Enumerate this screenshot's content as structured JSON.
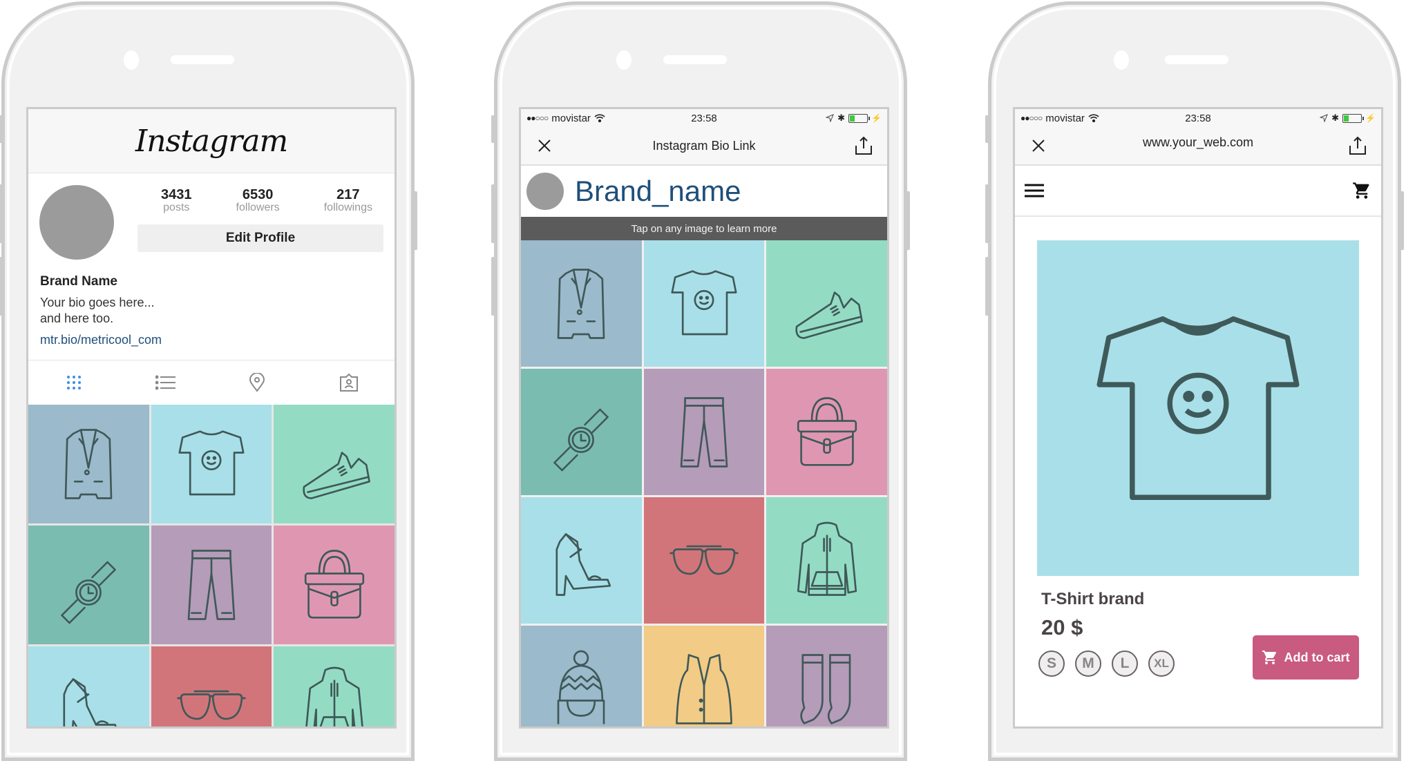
{
  "colors": {
    "tile_blue_gray": "#9bbacb",
    "tile_light_blue": "#a9dfe8",
    "tile_mint": "#93dcc3",
    "tile_teal": "#7bbcb0",
    "tile_mauve": "#b59cb9",
    "tile_pink": "#df97b1",
    "tile_red": "#d2757a",
    "tile_yellow": "#f2cb86",
    "link": "#1f4f7a",
    "accent_tab": "#3d8fe0",
    "add_to_cart": "#c95a80"
  },
  "phone1": {
    "app_logo": "Instagram",
    "stats": [
      {
        "value": "3431",
        "label": "posts"
      },
      {
        "value": "6530",
        "label": "followers"
      },
      {
        "value": "217",
        "label": "followings"
      }
    ],
    "edit_profile_label": "Edit Profile",
    "brand_name": "Brand Name",
    "bio": "Your bio goes here...\nand here too.",
    "link": "mtr.bio/metricool_com",
    "tabs": [
      "grid-icon",
      "list-icon",
      "location-pin-icon",
      "tagged-user-icon"
    ],
    "grid": [
      {
        "item": "blazer",
        "color": "#9bbacb"
      },
      {
        "item": "t-shirt",
        "color": "#a9dfe8"
      },
      {
        "item": "sneaker",
        "color": "#93dcc3"
      },
      {
        "item": "watch",
        "color": "#7bbcb0"
      },
      {
        "item": "pants",
        "color": "#b59cb9"
      },
      {
        "item": "handbag",
        "color": "#df97b1"
      },
      {
        "item": "heel-sandal",
        "color": "#a9dfe8"
      },
      {
        "item": "sunglasses",
        "color": "#d2757a"
      },
      {
        "item": "hoodie",
        "color": "#93dcc3"
      }
    ]
  },
  "phone2": {
    "status": {
      "carrier": "movistar",
      "signal": "●●○○○",
      "time": "23:58"
    },
    "nav_title": "Instagram Bio Link",
    "brand_name": "Brand_name",
    "tap_hint": "Tap on any image to learn more",
    "grid": [
      {
        "item": "blazer",
        "color": "#9bbacb"
      },
      {
        "item": "t-shirt",
        "color": "#a9dfe8"
      },
      {
        "item": "sneaker",
        "color": "#93dcc3"
      },
      {
        "item": "watch",
        "color": "#7bbcb0"
      },
      {
        "item": "pants",
        "color": "#b59cb9"
      },
      {
        "item": "handbag",
        "color": "#df97b1"
      },
      {
        "item": "heel-sandal",
        "color": "#a9dfe8"
      },
      {
        "item": "sunglasses",
        "color": "#d2757a"
      },
      {
        "item": "hoodie",
        "color": "#93dcc3"
      },
      {
        "item": "beanie",
        "color": "#9bbacb"
      },
      {
        "item": "vest",
        "color": "#f2cb86"
      },
      {
        "item": "socks",
        "color": "#b59cb9"
      }
    ]
  },
  "phone3": {
    "status": {
      "carrier": "movistar",
      "signal": "●●○○○",
      "time": "23:58"
    },
    "nav_title": "www.your_web.com",
    "product_name": "T-Shirt brand",
    "price": "20 $",
    "sizes": [
      "S",
      "M",
      "L",
      "XL"
    ],
    "add_to_cart_label": "Add to cart"
  }
}
